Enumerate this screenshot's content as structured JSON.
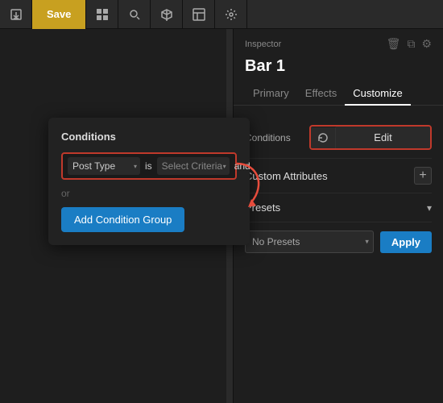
{
  "toolbar": {
    "save_label": "Save",
    "export_icon": "export-icon",
    "grid_icon": "grid-icon",
    "search_icon": "search-icon",
    "cube_icon": "cube-icon",
    "layout_icon": "layout-icon",
    "settings_icon": "settings-icon"
  },
  "inspector": {
    "label": "Inspector",
    "title": "Bar 1",
    "trash_icon": "trash-icon",
    "copy_icon": "copy-icon",
    "gear_icon": "gear-icon"
  },
  "tabs": [
    {
      "label": "Primary",
      "active": false
    },
    {
      "label": "Effects",
      "active": false
    },
    {
      "label": "Customize",
      "active": true
    }
  ],
  "conditions_card": {
    "title": "Conditions",
    "condition_type": "Post Type",
    "condition_is": "is",
    "condition_criteria_placeholder": "Select Criteria",
    "condition_and": "and",
    "or_text": "or",
    "add_condition_group_label": "Add Condition Group"
  },
  "right_panel": {
    "conditions_section": {
      "label": "Conditions",
      "refresh_icon": "refresh-icon",
      "edit_label": "Edit"
    },
    "custom_attributes": {
      "label": "Custom Attributes",
      "add_icon": "plus-icon"
    },
    "presets": {
      "label": "Presets",
      "chevron_icon": "chevron-down-icon",
      "no_presets_option": "No Presets",
      "apply_label": "Apply"
    }
  }
}
